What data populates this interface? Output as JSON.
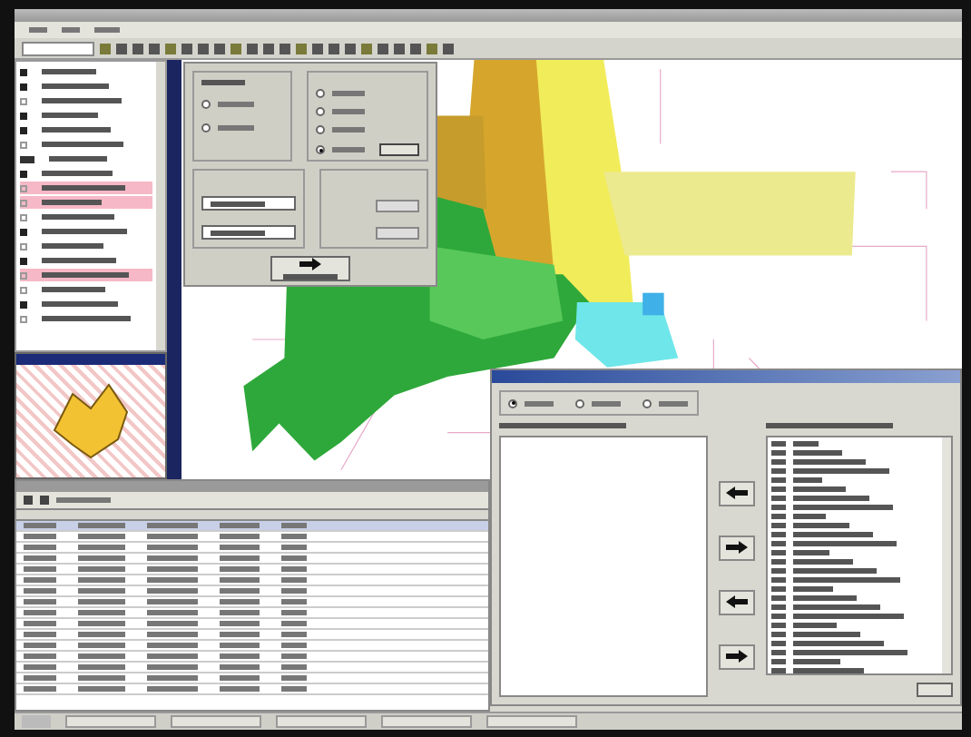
{
  "layers": [
    {
      "kind": "check",
      "checked": true,
      "highlighted": false
    },
    {
      "kind": "check",
      "checked": true,
      "highlighted": false
    },
    {
      "kind": "check",
      "checked": false,
      "highlighted": false
    },
    {
      "kind": "check",
      "checked": true,
      "highlighted": false
    },
    {
      "kind": "check",
      "checked": true,
      "highlighted": false
    },
    {
      "kind": "check",
      "checked": false,
      "highlighted": false
    },
    {
      "kind": "swatch",
      "checked": true,
      "highlighted": false
    },
    {
      "kind": "check",
      "checked": true,
      "highlighted": false
    },
    {
      "kind": "check",
      "checked": false,
      "highlighted": true
    },
    {
      "kind": "check",
      "checked": false,
      "highlighted": true
    },
    {
      "kind": "check",
      "checked": false,
      "highlighted": false
    },
    {
      "kind": "check",
      "checked": true,
      "highlighted": false
    },
    {
      "kind": "check",
      "checked": false,
      "highlighted": false
    },
    {
      "kind": "check",
      "checked": true,
      "highlighted": false
    },
    {
      "kind": "check",
      "checked": false,
      "highlighted": true
    },
    {
      "kind": "check",
      "checked": false,
      "highlighted": false
    },
    {
      "kind": "check",
      "checked": true,
      "highlighted": false
    },
    {
      "kind": "check",
      "checked": false,
      "highlighted": false
    }
  ],
  "dialog_left_radios": [
    {
      "selected": false
    },
    {
      "selected": false
    }
  ],
  "dialog_right_radios": [
    {
      "selected": false
    },
    {
      "selected": false
    },
    {
      "selected": false
    },
    {
      "selected": true
    }
  ],
  "lower_dialog_radios": [
    {
      "selected": true
    },
    {
      "selected": false
    },
    {
      "selected": false
    }
  ],
  "table_rows": [
    {
      "selected": true
    },
    {
      "selected": false
    },
    {
      "selected": false
    },
    {
      "selected": false
    },
    {
      "selected": false
    },
    {
      "selected": false
    },
    {
      "selected": false
    },
    {
      "selected": false
    },
    {
      "selected": false
    },
    {
      "selected": false
    },
    {
      "selected": false
    },
    {
      "selected": false
    },
    {
      "selected": false
    },
    {
      "selected": false
    },
    {
      "selected": false
    },
    {
      "selected": false
    }
  ]
}
